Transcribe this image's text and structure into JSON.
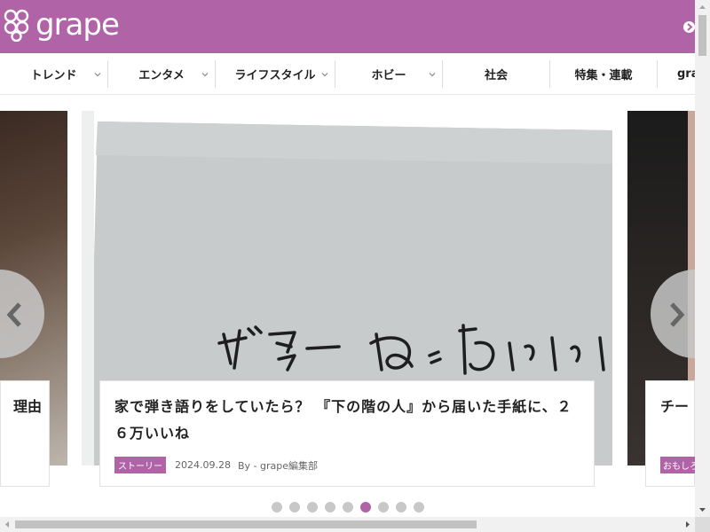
{
  "brand": {
    "logo_text": "grape",
    "color": "#b063a7"
  },
  "nav": {
    "items": [
      {
        "label": "トレンド"
      },
      {
        "label": "エンタメ"
      },
      {
        "label": "ライフスタイル"
      },
      {
        "label": "ホビー"
      },
      {
        "label": "社会"
      },
      {
        "label": "特集・連載"
      },
      {
        "label": "gra"
      }
    ]
  },
  "slides": {
    "left": {
      "title": "理由"
    },
    "main": {
      "title": "家で弾き語りをしていたら？ 『下の階の人』から届いた手紙に、２６万いいね",
      "category": "ストーリー",
      "date": "2024.09.28",
      "author": "By - grape編集部",
      "handwriting": "ギター めっちゃいい"
    },
    "right": {
      "title": "チー に笑",
      "category": "おもしろ"
    }
  },
  "carousel": {
    "total_slides": 9,
    "active_index": 5
  },
  "icons": {
    "prev": "chevron-left-icon",
    "next": "chevron-right-icon",
    "header_next": "chevron-right-icon",
    "nav_dropdown": "chevron-down-icon"
  }
}
